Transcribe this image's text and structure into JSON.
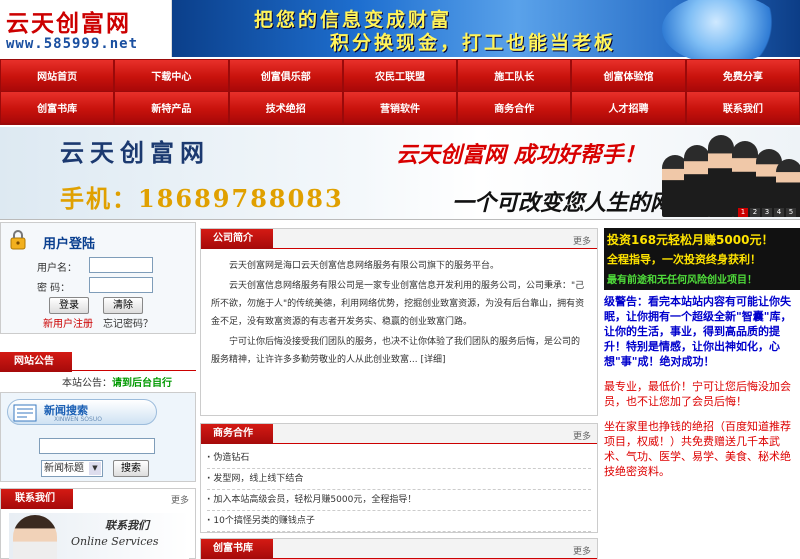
{
  "header": {
    "logo_title": "云天创富网",
    "logo_url": "www.585999.net",
    "banner_line1": "把您的信息变成财富",
    "banner_line2": "积分换现金，打工也能当老板"
  },
  "nav": {
    "row1": [
      "网站首页",
      "下载中心",
      "创富俱乐部",
      "农民工联盟",
      "施工队长",
      "创富体验馆",
      "免费分享"
    ],
    "row2": [
      "创富书库",
      "新特产品",
      "技术绝招",
      "营销软件",
      "商务合作",
      "人才招聘",
      "联系我们"
    ]
  },
  "hero": {
    "title": "云天创富网",
    "phone": "手机：18689788083",
    "slogan1": "云天创富网 成功好帮手！",
    "slogan2": "一个可改变您人生的网站！",
    "slides": [
      "1",
      "2",
      "3",
      "4",
      "5"
    ]
  },
  "login": {
    "title": "用户登陆",
    "username_label": "用户名：",
    "password_label": "密  码：",
    "login_button": "登录",
    "clear_button": "清除",
    "register_link": "新用户注册",
    "forgot_link": "忘记密码？"
  },
  "notice": {
    "title": "网站公告",
    "label": "本站公告：",
    "text": "请到后台自行"
  },
  "news_search": {
    "title": "新闻搜索",
    "subtitle": "XINWEN SOSUO",
    "select_value": "新闻标题",
    "search_button": "搜索"
  },
  "contact": {
    "title": "联系我们",
    "more": "更多",
    "img_title": "联系我们",
    "img_sub": "Online Services"
  },
  "company": {
    "title": "公司简介",
    "more": "更多",
    "p1": "云天创富网是海口云天创富信息网络服务有限公司旗下的服务平台。",
    "p2": "云天创富信息网络服务有限公司是一家专业创富信息开发利用的服务公司，公司秉承：\"己所不欲，勿施于人\"的传统美德，利用网络优势，挖掘创业致富资源，为没有后台靠山，拥有资金不足，没有致富资源的有志者开发务实、稳赢的创业致富门路。",
    "p3": "宁可让你后悔没接受我们团队的服务，也决不让你体验了我们团队的服务后悔，是公司的服务精神，让许许多多勤劳敬业的人从此创业致富... [详细]"
  },
  "business": {
    "title": "商务合作",
    "more": "更多",
    "items": [
      "伪造钻石",
      "发型网，线上线下结合",
      "加入本站高级会员，轻松月赚5000元，全程指导！",
      "10个搞怪另类的赚钱点子"
    ]
  },
  "library": {
    "title": "创富书库",
    "more": "更多"
  },
  "ad": {
    "line1": "投资168元轻松月赚5000元！",
    "line2": "全程指导，一次投资终身获利！",
    "line3": "最有前途和无任何风险创业项目！"
  },
  "right_text": {
    "p1": "级警告：看完本站站内容有可能让你失眠，让你拥有一个超级全新\"智囊\"库，让你的生活，事业，得到高品质的提升！特别是情感，让你出神如化，心想\"事\"成！绝对成功！",
    "p2": "最专业，最低价！宁可让您后悔没加会员，也不让您加了会员后悔！",
    "p3": "坐在家里也挣钱的绝招（百度知道推荐项目，权威！）共免费赠送几千本武术、气功、医学、易学、美食、秘术绝技绝密资料。"
  },
  "colors": {
    "brand_red": "#c8120c",
    "banner_blue": "#1e6fd0",
    "ad_yellow": "#ffe400"
  }
}
